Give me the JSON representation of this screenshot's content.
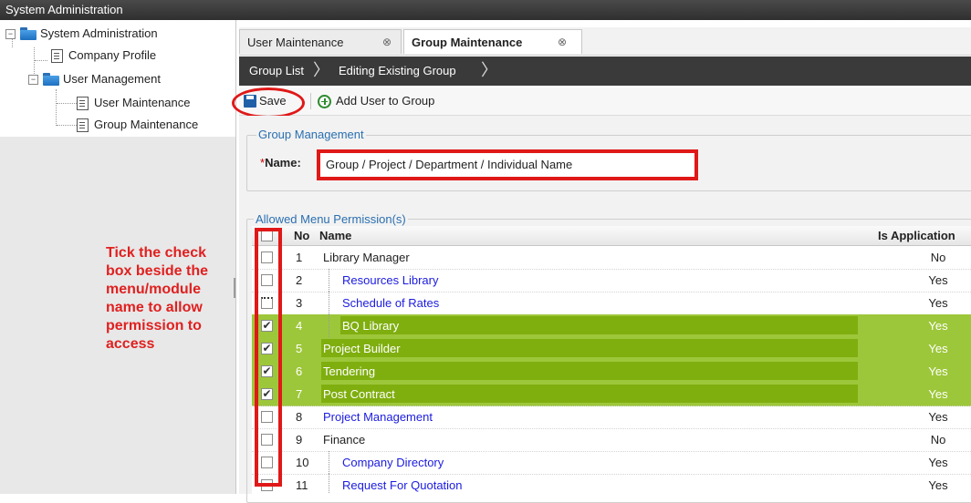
{
  "window": {
    "title": "System Administration"
  },
  "tree": {
    "root": "System Administration",
    "company_profile": "Company Profile",
    "user_management": "User Management",
    "user_maintenance": "User Maintenance",
    "group_maintenance": "Group Maintenance",
    "collapse_glyph": "−"
  },
  "annotation": "Tick the check\nbox beside the\nmenu/module\nname to allow\npermission to\naccess",
  "tabs": [
    {
      "label": "User Maintenance",
      "close": "⊗"
    },
    {
      "label": "Group Maintenance",
      "close": "⊗"
    }
  ],
  "breadcrumb": {
    "group_list": "Group List",
    "editing": "Editing Existing Group",
    "sep": "〉"
  },
  "toolbar": {
    "save_label": "Save",
    "add_user_label": "Add User to Group"
  },
  "group_management": {
    "legend": "Group Management",
    "name_required": "*",
    "name_label": "Name:",
    "name_value": "Group / Project / Department / Individual Name"
  },
  "permissions": {
    "legend": "Allowed Menu Permission(s)",
    "columns": {
      "no": "No",
      "name": "Name",
      "is_application": "Is Application"
    },
    "rows": [
      {
        "no": "1",
        "name": "Library Manager",
        "app": "No",
        "checked": false,
        "link": false,
        "indent": 0
      },
      {
        "no": "2",
        "name": "Resources Library",
        "app": "Yes",
        "checked": false,
        "link": true,
        "indent": 1
      },
      {
        "no": "3",
        "name": "Schedule of Rates",
        "app": "Yes",
        "checked": false,
        "link": true,
        "indent": 1
      },
      {
        "no": "4",
        "name": "BQ Library",
        "app": "Yes",
        "checked": true,
        "link": true,
        "indent": 1
      },
      {
        "no": "5",
        "name": "Project Builder",
        "app": "Yes",
        "checked": true,
        "link": true,
        "indent": 0
      },
      {
        "no": "6",
        "name": "Tendering",
        "app": "Yes",
        "checked": true,
        "link": true,
        "indent": 0
      },
      {
        "no": "7",
        "name": "Post Contract",
        "app": "Yes",
        "checked": true,
        "link": true,
        "indent": 0
      },
      {
        "no": "8",
        "name": "Project Management",
        "app": "Yes",
        "checked": false,
        "link": true,
        "indent": 0
      },
      {
        "no": "9",
        "name": "Finance",
        "app": "No",
        "checked": false,
        "link": false,
        "indent": 0
      },
      {
        "no": "10",
        "name": "Company Directory",
        "app": "Yes",
        "checked": false,
        "link": true,
        "indent": 1
      },
      {
        "no": "11",
        "name": "Request For Quotation",
        "app": "Yes",
        "checked": false,
        "link": true,
        "indent": 1
      }
    ],
    "check_glyph": "✔"
  },
  "colors": {
    "selected_row": "#9dc73a",
    "highlight": "#e01818",
    "link": "#1b1be0"
  }
}
